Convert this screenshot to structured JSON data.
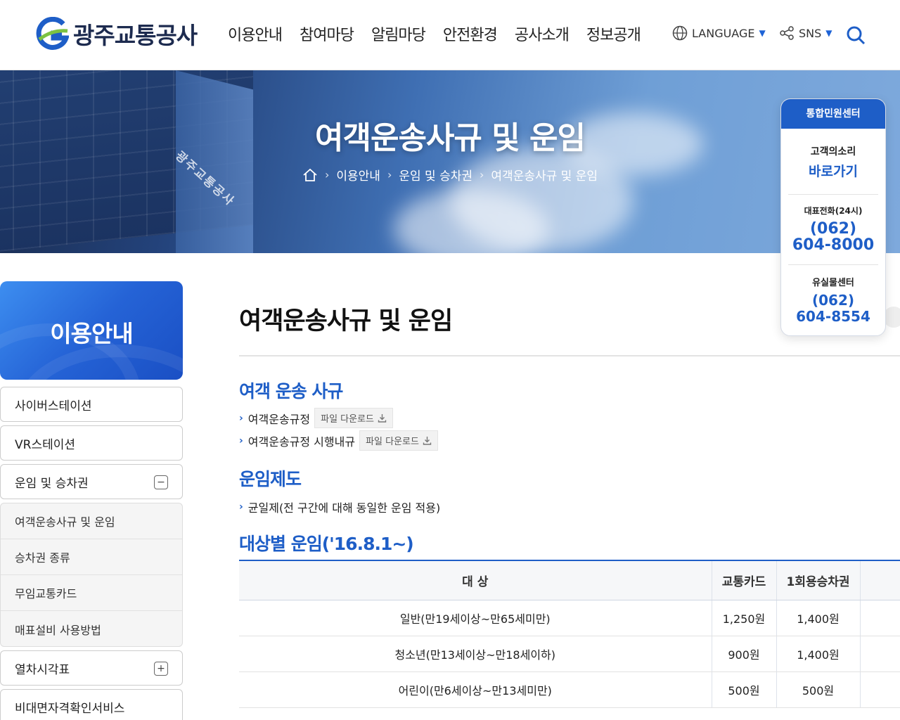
{
  "header": {
    "logo_text": "광주교통공사",
    "nav": [
      "이용안내",
      "참여마당",
      "알림마당",
      "안전환경",
      "공사소개",
      "정보공개"
    ],
    "language_label": "LANGUAGE",
    "sns_label": "SNS",
    "accent_color": "#1e5ec7"
  },
  "banner": {
    "title": "여객운송사규 및 운임",
    "building_sign": "광주교통공사",
    "breadcrumb": [
      "이용안내",
      "운임 및 승차권",
      "여객운송사규 및 운임"
    ]
  },
  "quick": {
    "title": "통합민원센터",
    "voice_label": "고객의소리",
    "voice_link": "바로가기",
    "main_phone_label": "대표전화(24시)",
    "main_phone_area": "(062)",
    "main_phone_number": "604-8000",
    "lost_label": "유실물센터",
    "lost_area": "(062)",
    "lost_number": "604-8554"
  },
  "sidebar": {
    "title": "이용안내",
    "items": [
      "사이버스테이션",
      "VR스테이션",
      "운임 및 승차권"
    ],
    "sub_items": [
      "여객운송사규 및 운임",
      "승차권 종류",
      "무임교통카드",
      "매표설비 사용방법"
    ],
    "items_after": [
      "열차시각표",
      "비대면자격확인서비스"
    ],
    "toggle_open": "−",
    "toggle_closed": "+"
  },
  "content": {
    "page_title": "여객운송사규 및 운임",
    "section1_title": "여객 운송 사규",
    "docs": [
      {
        "label": "여객운송규정",
        "download": "파일 다운로드"
      },
      {
        "label": "여객운송규정 시행내규",
        "download": "파일 다운로드"
      }
    ],
    "section2_title": "운임제도",
    "fare_system": "균일제(전 구간에 대해 동일한 운임 적용)",
    "section3_title": "대상별 운임('16.8.1~)",
    "table": {
      "headers": [
        "대 상",
        "교통카드",
        "1회용승차권",
        ""
      ],
      "rows": [
        [
          "일반(만19세이상~만65세미만)",
          "1,250원",
          "1,400원",
          ""
        ],
        [
          "청소년(만13세이상~만18세이하)",
          "900원",
          "1,400원",
          ""
        ],
        [
          "어린이(만6세이상~만13세미만)",
          "500원",
          "500원",
          ""
        ]
      ]
    }
  }
}
